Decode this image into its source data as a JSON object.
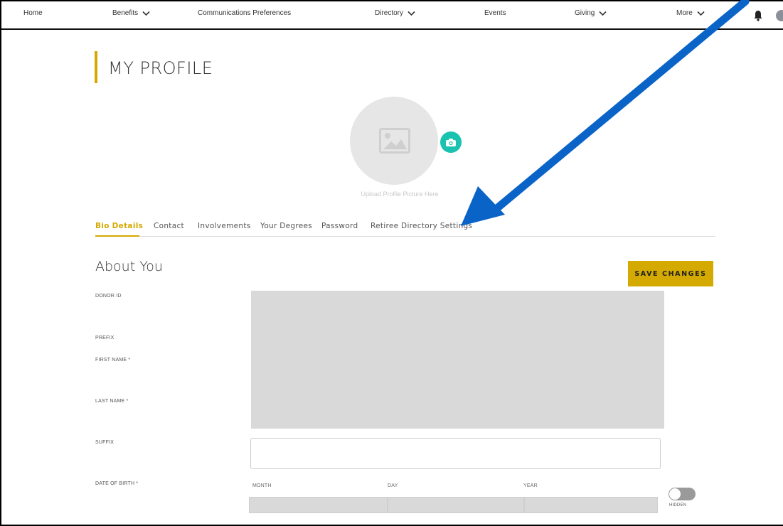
{
  "nav": {
    "home": "Home",
    "benefits": "Benefits",
    "communications": "Communications Preferences",
    "directory": "Directory",
    "events": "Events",
    "giving": "Giving",
    "more": "More"
  },
  "page": {
    "title": "MY PROFILE"
  },
  "profile_picture": {
    "upload_label": "Upload Profile Picture Here"
  },
  "tabs": [
    {
      "label": "Bio Details",
      "active": true
    },
    {
      "label": "Contact"
    },
    {
      "label": "Involvements"
    },
    {
      "label": "Your Degrees"
    },
    {
      "label": "Password"
    },
    {
      "label": "Retiree Directory Settings"
    }
  ],
  "section": {
    "title": "About You",
    "save_label": "SAVE CHANGES"
  },
  "fields": {
    "donor_id": "DONOR ID",
    "prefix": "PREFIX",
    "first_name": "FIRST NAME *",
    "last_name": "LAST NAME *",
    "suffix": "SUFFIX",
    "dob": "DATE OF BIRTH *"
  },
  "dob": {
    "month": "MONTH",
    "day": "DAY",
    "year": "YEAR",
    "hidden_label": "HIDDEN"
  },
  "colors": {
    "accent": "#d4a900",
    "camera": "#1ac2b0",
    "arrow": "#0a64c8"
  },
  "icons": [
    "chevron-down-icon",
    "bell-icon",
    "user-avatar-icon",
    "image-placeholder-icon",
    "camera-icon"
  ]
}
